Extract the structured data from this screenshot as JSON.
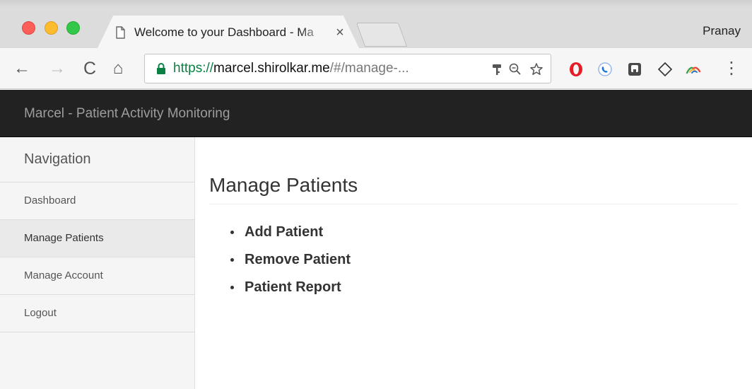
{
  "browser": {
    "tab": {
      "title": "Welcome to your Dashboard - Ma",
      "close": "×"
    },
    "profile_name": "Pranay",
    "nav": {
      "back": "←",
      "forward": "→",
      "reload": "C",
      "home": "⌂",
      "menu": "⋮"
    },
    "url": {
      "scheme": "https://",
      "host": "marcel.shirolkar.me",
      "path": "/#/manage-..."
    },
    "icons": [
      "lock-icon",
      "key-icon",
      "zoom-icon",
      "star-icon",
      "opera-icon",
      "skype-icon",
      "extension-box-icon",
      "diamond-icon",
      "wave-icon"
    ]
  },
  "app": {
    "brand": "Marcel - Patient Activity Monitoring",
    "colors": {
      "header_bg": "#222222",
      "brand_text": "#9d9d9d",
      "sidebar_bg": "#f5f5f5",
      "url_scheme": "#0b8043"
    }
  },
  "sidebar": {
    "heading": "Navigation",
    "items": [
      {
        "label": "Dashboard",
        "active": false
      },
      {
        "label": "Manage Patients",
        "active": true
      },
      {
        "label": "Manage Account",
        "active": false
      },
      {
        "label": "Logout",
        "active": false
      }
    ]
  },
  "main": {
    "title": "Manage Patients",
    "actions": [
      {
        "label": "Add Patient"
      },
      {
        "label": "Remove Patient"
      },
      {
        "label": "Patient Report"
      }
    ]
  }
}
